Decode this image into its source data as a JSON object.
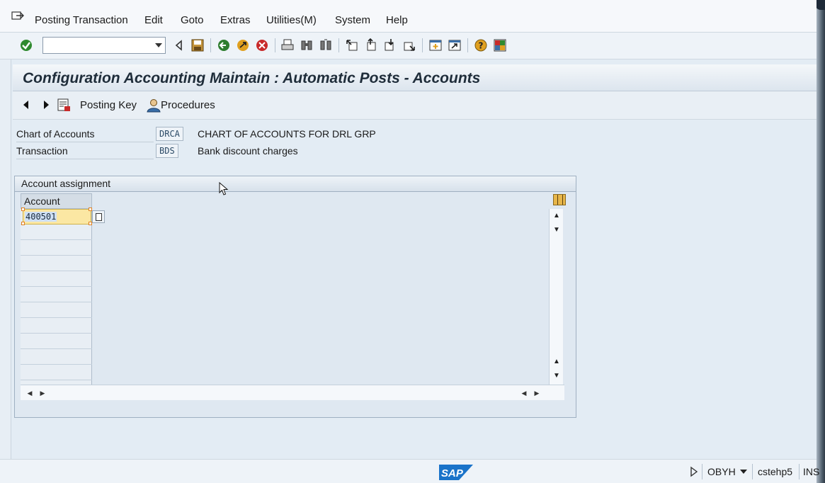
{
  "menu": {
    "items": [
      "Posting Transaction",
      "Edit",
      "Goto",
      "Extras",
      "Utilities(M)",
      "System",
      "Help"
    ]
  },
  "toolbar": {
    "command_value": "",
    "icons": [
      "enter-icon",
      "back-nav-icon",
      "save-icon",
      "back-icon",
      "exit-icon",
      "cancel-icon",
      "print-icon",
      "find-icon",
      "find-next-icon",
      "first-page-icon",
      "prev-page-icon",
      "next-page-icon",
      "last-page-icon",
      "create-session-icon",
      "shortcut-icon",
      "help-icon",
      "layout-icon"
    ]
  },
  "title": "Configuration Accounting Maintain : Automatic Posts - Accounts",
  "app_toolbar": {
    "posting_key": "Posting Key",
    "procedures": "Procedures"
  },
  "fields": {
    "chart_of_accounts": {
      "label": "Chart of Accounts",
      "value": "DRCA",
      "description": "CHART OF ACCOUNTS FOR DRL GRP"
    },
    "transaction": {
      "label": "Transaction",
      "value": "BDS",
      "description": "Bank discount charges"
    }
  },
  "account_assignment": {
    "title": "Account assignment",
    "column_header": "Account",
    "rows": [
      "400501",
      "",
      "",
      "",
      "",
      "",
      "",
      "",
      "",
      "",
      ""
    ]
  },
  "status": {
    "transaction_code": "OBYH",
    "server": "cstehp5",
    "mode": "INS"
  },
  "colors": {
    "title_bg": "#dce5ee",
    "input_highlight": "#fbe7a3",
    "sap_blue": "#1a73c9"
  }
}
